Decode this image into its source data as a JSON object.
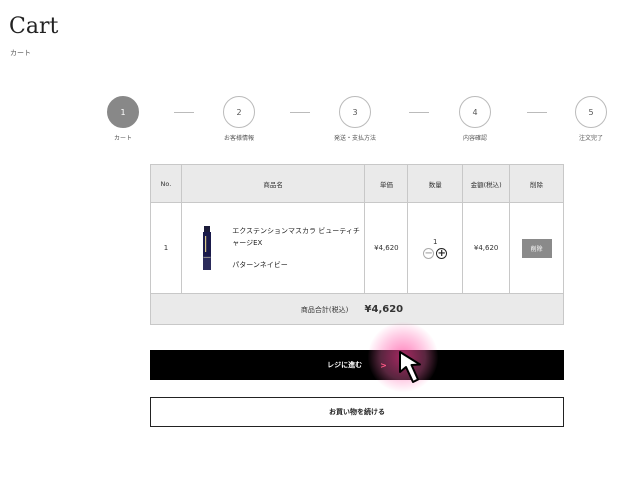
{
  "page": {
    "title": "Cart",
    "subtitle": "カート"
  },
  "steps": [
    {
      "number": "1",
      "label": "カート",
      "active": true
    },
    {
      "number": "2",
      "label": "お客様情報",
      "active": false
    },
    {
      "number": "3",
      "label": "発送・支払方法",
      "active": false
    },
    {
      "number": "4",
      "label": "内容確認",
      "active": false
    },
    {
      "number": "5",
      "label": "注文完了",
      "active": false
    }
  ],
  "table": {
    "headers": {
      "no": "No.",
      "name": "商品名",
      "price": "単価",
      "qty": "数量",
      "amount": "金額(税込)",
      "delete": "削除"
    },
    "items": [
      {
        "no": "1",
        "name": "エクステンションマスカラ ビューティチャージEX",
        "variant": "パターンネイビー",
        "price": "¥4,620",
        "qty": "1",
        "amount": "¥4,620",
        "delete_label": "削除"
      }
    ],
    "total_label": "商品合計(税込)",
    "total_value": "¥4,620"
  },
  "buttons": {
    "checkout_label": "レジに進む",
    "checkout_chevron": ">",
    "continue_label": "お買い物を続ける"
  },
  "icons": {
    "qty_minus": "minus-circle-icon",
    "qty_plus": "plus-circle-icon",
    "cursor": "arrow-cursor-icon"
  },
  "colors": {
    "active_step": "#888888",
    "checkout_bg": "#000000",
    "accent": "#ff4d6d",
    "table_header": "#eaeaea"
  }
}
